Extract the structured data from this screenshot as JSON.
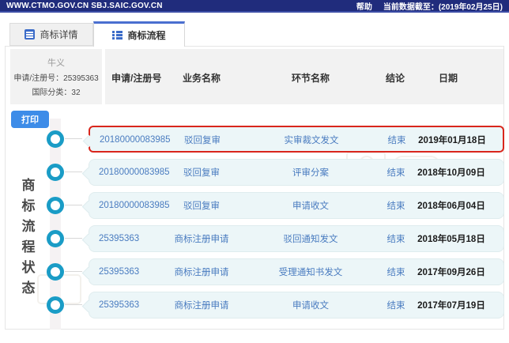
{
  "topbar": {
    "site": "WWW.CTMO.GOV.CN SBJ.SAIC.GOV.CN",
    "help": "帮助",
    "data_note": "当前数据截至：(2019年02月25日)"
  },
  "tabs": [
    {
      "label": "商标详情",
      "icon": "document-icon",
      "active": false
    },
    {
      "label": "商标流程",
      "icon": "list-icon",
      "active": true
    }
  ],
  "info": {
    "name": "牛义",
    "reg_line": "申请/注册号：25395363",
    "class_line": "国际分类：32"
  },
  "print_label": "打印",
  "side_label": "商标流程状态",
  "table": {
    "headers": [
      "申请/注册号",
      "业务名称",
      "环节名称",
      "结论",
      "日期"
    ],
    "rows": [
      {
        "no": "20180000083985",
        "business": "驳回复审",
        "stage": "实审裁文发文",
        "conclusion": "结束",
        "date": "2019年01月18日",
        "highlighted": true
      },
      {
        "no": "20180000083985",
        "business": "驳回复审",
        "stage": "评审分案",
        "conclusion": "结束",
        "date": "2018年10月09日",
        "highlighted": false
      },
      {
        "no": "20180000083985",
        "business": "驳回复审",
        "stage": "申请收文",
        "conclusion": "结束",
        "date": "2018年06月04日",
        "highlighted": false
      },
      {
        "no": "25395363",
        "business": "商标注册申请",
        "stage": "驳回通知发文",
        "conclusion": "结束",
        "date": "2018年05月18日",
        "highlighted": false
      },
      {
        "no": "25395363",
        "business": "商标注册申请",
        "stage": "受理通知书发文",
        "conclusion": "结束",
        "date": "2017年09月26日",
        "highlighted": false
      },
      {
        "no": "25395363",
        "business": "商标注册申请",
        "stage": "申请收文",
        "conclusion": "结束",
        "date": "2017年07月19日",
        "highlighted": false
      }
    ]
  },
  "colors": {
    "topbar_bg": "#202c7c",
    "active_tab_accent": "#4a6fd0",
    "print_button": "#3d8ce8",
    "timeline_ring": "#1a9cc6",
    "row_bg": "#ecf6f8",
    "highlight_border": "#d9261c",
    "link_text": "#4a7cc0"
  }
}
